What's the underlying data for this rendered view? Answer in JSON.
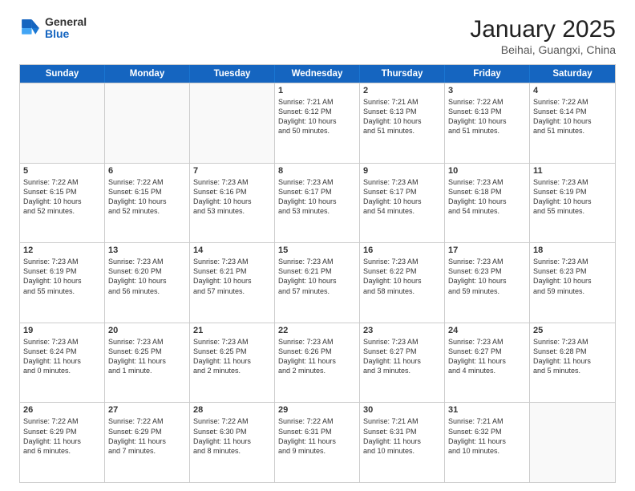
{
  "header": {
    "logo_general": "General",
    "logo_blue": "Blue",
    "title": "January 2025",
    "subtitle": "Beihai, Guangxi, China"
  },
  "days_of_week": [
    "Sunday",
    "Monday",
    "Tuesday",
    "Wednesday",
    "Thursday",
    "Friday",
    "Saturday"
  ],
  "weeks": [
    [
      {
        "day": "",
        "info": "",
        "empty": true
      },
      {
        "day": "",
        "info": "",
        "empty": true
      },
      {
        "day": "",
        "info": "",
        "empty": true
      },
      {
        "day": "1",
        "info": "Sunrise: 7:21 AM\nSunset: 6:12 PM\nDaylight: 10 hours\nand 50 minutes.",
        "empty": false
      },
      {
        "day": "2",
        "info": "Sunrise: 7:21 AM\nSunset: 6:13 PM\nDaylight: 10 hours\nand 51 minutes.",
        "empty": false
      },
      {
        "day": "3",
        "info": "Sunrise: 7:22 AM\nSunset: 6:13 PM\nDaylight: 10 hours\nand 51 minutes.",
        "empty": false
      },
      {
        "day": "4",
        "info": "Sunrise: 7:22 AM\nSunset: 6:14 PM\nDaylight: 10 hours\nand 51 minutes.",
        "empty": false
      }
    ],
    [
      {
        "day": "5",
        "info": "Sunrise: 7:22 AM\nSunset: 6:15 PM\nDaylight: 10 hours\nand 52 minutes.",
        "empty": false
      },
      {
        "day": "6",
        "info": "Sunrise: 7:22 AM\nSunset: 6:15 PM\nDaylight: 10 hours\nand 52 minutes.",
        "empty": false
      },
      {
        "day": "7",
        "info": "Sunrise: 7:23 AM\nSunset: 6:16 PM\nDaylight: 10 hours\nand 53 minutes.",
        "empty": false
      },
      {
        "day": "8",
        "info": "Sunrise: 7:23 AM\nSunset: 6:17 PM\nDaylight: 10 hours\nand 53 minutes.",
        "empty": false
      },
      {
        "day": "9",
        "info": "Sunrise: 7:23 AM\nSunset: 6:17 PM\nDaylight: 10 hours\nand 54 minutes.",
        "empty": false
      },
      {
        "day": "10",
        "info": "Sunrise: 7:23 AM\nSunset: 6:18 PM\nDaylight: 10 hours\nand 54 minutes.",
        "empty": false
      },
      {
        "day": "11",
        "info": "Sunrise: 7:23 AM\nSunset: 6:19 PM\nDaylight: 10 hours\nand 55 minutes.",
        "empty": false
      }
    ],
    [
      {
        "day": "12",
        "info": "Sunrise: 7:23 AM\nSunset: 6:19 PM\nDaylight: 10 hours\nand 55 minutes.",
        "empty": false
      },
      {
        "day": "13",
        "info": "Sunrise: 7:23 AM\nSunset: 6:20 PM\nDaylight: 10 hours\nand 56 minutes.",
        "empty": false
      },
      {
        "day": "14",
        "info": "Sunrise: 7:23 AM\nSunset: 6:21 PM\nDaylight: 10 hours\nand 57 minutes.",
        "empty": false
      },
      {
        "day": "15",
        "info": "Sunrise: 7:23 AM\nSunset: 6:21 PM\nDaylight: 10 hours\nand 57 minutes.",
        "empty": false
      },
      {
        "day": "16",
        "info": "Sunrise: 7:23 AM\nSunset: 6:22 PM\nDaylight: 10 hours\nand 58 minutes.",
        "empty": false
      },
      {
        "day": "17",
        "info": "Sunrise: 7:23 AM\nSunset: 6:23 PM\nDaylight: 10 hours\nand 59 minutes.",
        "empty": false
      },
      {
        "day": "18",
        "info": "Sunrise: 7:23 AM\nSunset: 6:23 PM\nDaylight: 10 hours\nand 59 minutes.",
        "empty": false
      }
    ],
    [
      {
        "day": "19",
        "info": "Sunrise: 7:23 AM\nSunset: 6:24 PM\nDaylight: 11 hours\nand 0 minutes.",
        "empty": false
      },
      {
        "day": "20",
        "info": "Sunrise: 7:23 AM\nSunset: 6:25 PM\nDaylight: 11 hours\nand 1 minute.",
        "empty": false
      },
      {
        "day": "21",
        "info": "Sunrise: 7:23 AM\nSunset: 6:25 PM\nDaylight: 11 hours\nand 2 minutes.",
        "empty": false
      },
      {
        "day": "22",
        "info": "Sunrise: 7:23 AM\nSunset: 6:26 PM\nDaylight: 11 hours\nand 2 minutes.",
        "empty": false
      },
      {
        "day": "23",
        "info": "Sunrise: 7:23 AM\nSunset: 6:27 PM\nDaylight: 11 hours\nand 3 minutes.",
        "empty": false
      },
      {
        "day": "24",
        "info": "Sunrise: 7:23 AM\nSunset: 6:27 PM\nDaylight: 11 hours\nand 4 minutes.",
        "empty": false
      },
      {
        "day": "25",
        "info": "Sunrise: 7:23 AM\nSunset: 6:28 PM\nDaylight: 11 hours\nand 5 minutes.",
        "empty": false
      }
    ],
    [
      {
        "day": "26",
        "info": "Sunrise: 7:22 AM\nSunset: 6:29 PM\nDaylight: 11 hours\nand 6 minutes.",
        "empty": false
      },
      {
        "day": "27",
        "info": "Sunrise: 7:22 AM\nSunset: 6:29 PM\nDaylight: 11 hours\nand 7 minutes.",
        "empty": false
      },
      {
        "day": "28",
        "info": "Sunrise: 7:22 AM\nSunset: 6:30 PM\nDaylight: 11 hours\nand 8 minutes.",
        "empty": false
      },
      {
        "day": "29",
        "info": "Sunrise: 7:22 AM\nSunset: 6:31 PM\nDaylight: 11 hours\nand 9 minutes.",
        "empty": false
      },
      {
        "day": "30",
        "info": "Sunrise: 7:21 AM\nSunset: 6:31 PM\nDaylight: 11 hours\nand 10 minutes.",
        "empty": false
      },
      {
        "day": "31",
        "info": "Sunrise: 7:21 AM\nSunset: 6:32 PM\nDaylight: 11 hours\nand 10 minutes.",
        "empty": false
      },
      {
        "day": "",
        "info": "",
        "empty": true
      }
    ]
  ]
}
